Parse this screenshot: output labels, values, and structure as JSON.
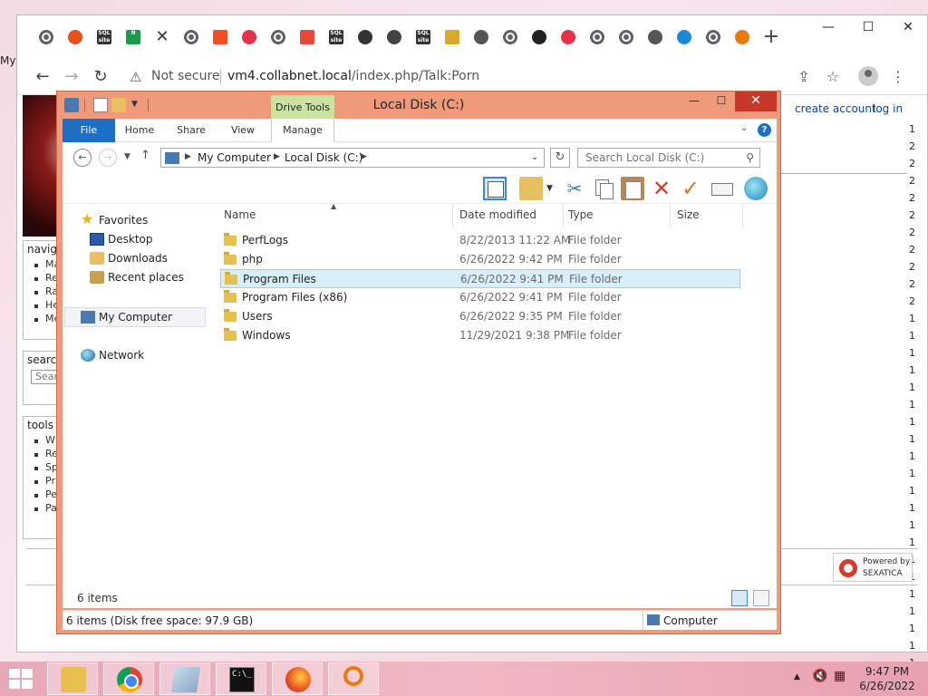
{
  "desktop": {
    "label": "My"
  },
  "browser": {
    "tabs": [
      {
        "icon": "globe-icon"
      },
      {
        "icon": "flame-icon"
      },
      {
        "icon": "sql-site-icon",
        "text": "SQL site"
      },
      {
        "icon": "n-icon",
        "text": "N"
      },
      {
        "icon": "close-icon"
      },
      {
        "icon": "globe-icon"
      },
      {
        "icon": "microsoft-icon"
      },
      {
        "icon": "ring-icon"
      },
      {
        "icon": "globe-icon"
      },
      {
        "icon": "calendar-icon"
      },
      {
        "icon": "sql-site-icon",
        "text": "SQL site"
      },
      {
        "icon": "wordpress-icon"
      },
      {
        "icon": "diamond-icon"
      },
      {
        "icon": "sql-site-icon",
        "text": "SQL site"
      },
      {
        "icon": "folder-icon"
      },
      {
        "icon": "gear-icon"
      },
      {
        "icon": "globe-icon"
      },
      {
        "icon": "ubuntu-icon"
      },
      {
        "icon": "ring-icon"
      },
      {
        "icon": "globe-icon"
      },
      {
        "icon": "globe-icon"
      },
      {
        "icon": "gear-icon"
      },
      {
        "icon": "cloud-icon"
      },
      {
        "icon": "globe-icon"
      },
      {
        "icon": "magnifier-icon"
      }
    ],
    "new_tab": "+",
    "window_controls": {
      "minimize": "—",
      "maximize": "☐",
      "close": "✕"
    },
    "back": "←",
    "forward": "→",
    "reload": "↻",
    "security_label": "Not secure",
    "url_host": "vm4.collabnet.local",
    "url_path": "/index.php/Talk:Porn",
    "share": "⇪",
    "star": "☆",
    "menu": "⋮"
  },
  "webpage": {
    "nav_header": "navigation",
    "nav_items": [
      "Ma",
      "Re",
      "Ra",
      "He",
      "Me"
    ],
    "search_header": "search",
    "search_placeholder": "Sear",
    "tools_header": "tools",
    "tools_items": [
      "W",
      "Re",
      "Sp",
      "Pr",
      "Pe",
      "Pa"
    ],
    "create_account": "create account",
    "log_in": "log in",
    "right_digits": [
      "1",
      "2",
      "2",
      "2",
      "2",
      "2",
      "2",
      "2",
      "2",
      "2",
      "2",
      "1",
      "1",
      "1",
      "1",
      "1",
      "1",
      "1",
      "1",
      "1",
      "1",
      "1",
      "1",
      "1",
      "1",
      "1",
      "1",
      "1",
      "1",
      "1",
      "1",
      "1",
      "1"
    ],
    "powered_by": "Powered by",
    "powered_name": "SEXATICA"
  },
  "explorer": {
    "title": "Local Disk (C:)",
    "contextual_tab": "Drive Tools",
    "window_controls": {
      "minimize": "—",
      "maximize": "☐",
      "close": "✕"
    },
    "ribbon_tabs": [
      "File",
      "Home",
      "Share",
      "View",
      "Manage"
    ],
    "help": "?",
    "breadcrumb": [
      "My Computer",
      "Local Disk (C:)"
    ],
    "search_placeholder": "Search Local Disk (C:)",
    "nav": {
      "favorites": "Favorites",
      "desktop": "Desktop",
      "downloads": "Downloads",
      "recent": "Recent places",
      "computer": "My Computer",
      "network": "Network"
    },
    "columns": [
      "Name",
      "Date modified",
      "Type",
      "Size"
    ],
    "files": [
      {
        "name": "PerfLogs",
        "date": "8/22/2013 11:22 AM",
        "type": "File folder",
        "size": ""
      },
      {
        "name": "php",
        "date": "6/26/2022 9:42 PM",
        "type": "File folder",
        "size": ""
      },
      {
        "name": "Program Files",
        "date": "6/26/2022 9:41 PM",
        "type": "File folder",
        "size": ""
      },
      {
        "name": "Program Files (x86)",
        "date": "6/26/2022 9:41 PM",
        "type": "File folder",
        "size": ""
      },
      {
        "name": "Users",
        "date": "6/26/2022 9:35 PM",
        "type": "File folder",
        "size": ""
      },
      {
        "name": "Windows",
        "date": "11/29/2021 9:38 PM",
        "type": "File folder",
        "size": ""
      }
    ],
    "selected_row": "Program Files",
    "item_count": "6 items",
    "status_left": "6 items (Disk free space: 97.9 GB)",
    "status_right": "Computer"
  },
  "taskbar": {
    "apps": [
      "file-explorer-icon",
      "chrome-icon",
      "notepad-icon",
      "command-prompt-icon",
      "firefox-icon",
      "magnifier-icon"
    ],
    "cmd_text": "C:\\_",
    "tray_arrow": "▲",
    "time": "9:47 PM",
    "date": "6/26/2022"
  }
}
